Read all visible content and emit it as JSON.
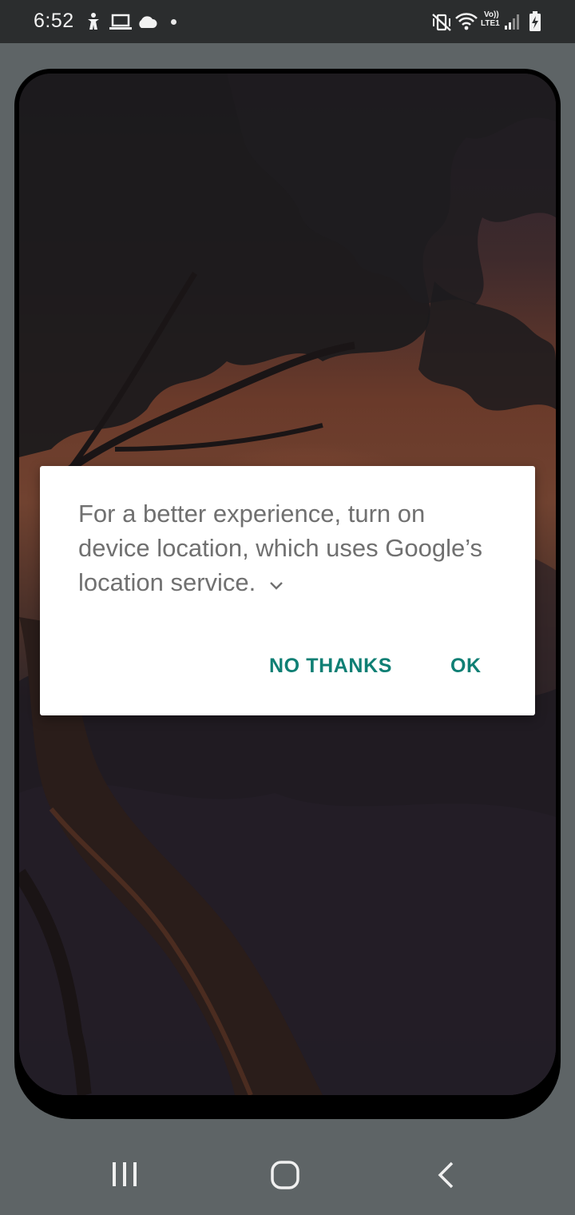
{
  "status_bar": {
    "time": "6:52",
    "network_label_top": "Vo))",
    "network_label_bottom": "LTE1",
    "icons": [
      "accessibility-icon",
      "laptop-icon",
      "cloud-icon",
      "notification-dot",
      "vibrate-mute-icon",
      "wifi-icon",
      "lte-icon",
      "signal-icon",
      "battery-charging-icon"
    ]
  },
  "dialog": {
    "message": "For a better experience, turn on device location, which uses Google’s location service.",
    "expand_icon": "chevron-down-icon",
    "negative_button": "NO THANKS",
    "positive_button": "OK",
    "accent_color": "#0f7f74"
  },
  "nav_bar": {
    "icons": [
      "recents-icon",
      "home-icon",
      "back-icon"
    ]
  }
}
